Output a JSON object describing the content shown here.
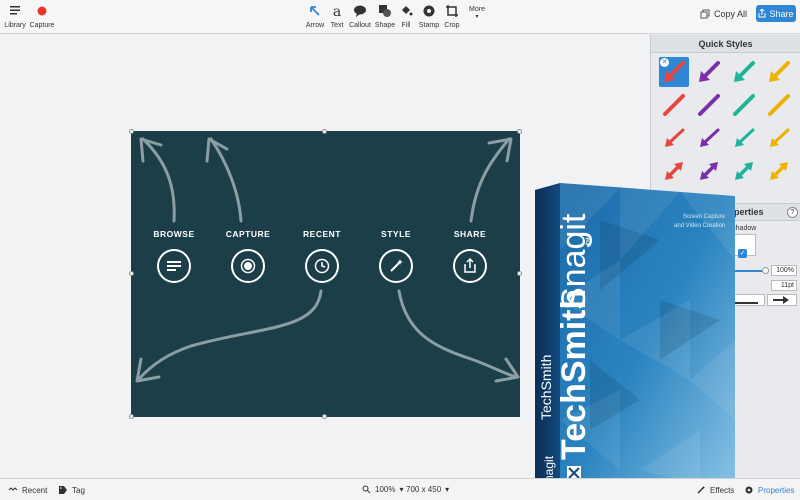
{
  "toolbar": {
    "library": "Library",
    "capture": "Capture",
    "tools": {
      "arrow": "Arrow",
      "text": "Text",
      "callout": "Callout",
      "shape": "Shape",
      "fill": "Fill",
      "stamp": "Stamp",
      "crop": "Crop",
      "more": "More"
    },
    "copy_all": "Copy All",
    "share": "Share"
  },
  "canvas_image": {
    "labels": [
      "BROWSE",
      "CAPTURE",
      "RECENT",
      "STYLE",
      "SHARE"
    ],
    "icons": [
      "menu-icon",
      "record-icon",
      "clock-icon",
      "magic-wand-icon",
      "share-icon"
    ],
    "background": "#1c3e48"
  },
  "quick_styles": {
    "title": "Quick Styles",
    "colors": [
      "#e8453c",
      "#7b2fa8",
      "#1fb39a",
      "#f0b200"
    ]
  },
  "properties": {
    "title": "Properties",
    "help": "?",
    "shadow_label": "Shadow",
    "opacity": "100%",
    "width": "11pt"
  },
  "product_box": {
    "brand": "TechSmith",
    "product": "Snagit",
    "tm": "™",
    "tagline_1": "Screen Capture",
    "tagline_2": "and Video Creation"
  },
  "statusbar": {
    "recent": "Recent",
    "tag": "Tag",
    "zoom": "100%",
    "dimensions": "700 x 450",
    "effects": "Effects",
    "properties": "Properties"
  },
  "colors": {
    "accent": "#2f86d4",
    "image_bg": "#1c3e48",
    "box_dark": "#0c3d6b"
  }
}
